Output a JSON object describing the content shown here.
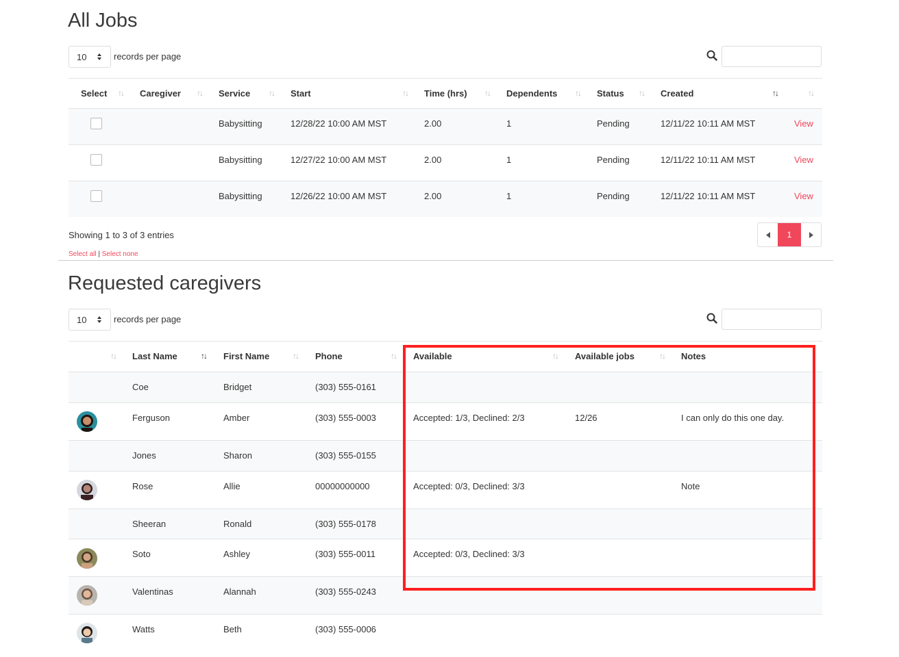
{
  "jobs": {
    "title": "All Jobs",
    "length_value": "10",
    "length_label": "records per page",
    "columns": [
      "Select",
      "Caregiver",
      "Service",
      "Start",
      "Time (hrs)",
      "Dependents",
      "Status",
      "Created"
    ],
    "rows": [
      {
        "caregiver": "",
        "service": "Babysitting",
        "start": "12/28/22 10:00 AM MST",
        "time": "2.00",
        "dependents": "1",
        "status": "Pending",
        "created": "12/11/22 10:11 AM MST",
        "action": "View"
      },
      {
        "caregiver": "",
        "service": "Babysitting",
        "start": "12/27/22 10:00 AM MST",
        "time": "2.00",
        "dependents": "1",
        "status": "Pending",
        "created": "12/11/22 10:11 AM MST",
        "action": "View"
      },
      {
        "caregiver": "",
        "service": "Babysitting",
        "start": "12/26/22 10:00 AM MST",
        "time": "2.00",
        "dependents": "1",
        "status": "Pending",
        "created": "12/11/22 10:11 AM MST",
        "action": "View"
      }
    ],
    "info": "Showing 1 to 3 of 3 entries",
    "select_all": "Select all",
    "separator": " | ",
    "select_none": "Select none",
    "current_page": "1"
  },
  "caregivers": {
    "title": "Requested caregivers",
    "length_value": "10",
    "length_label": "records per page",
    "columns": [
      "Last Name",
      "First Name",
      "Phone",
      "Available",
      "Available jobs",
      "Notes"
    ],
    "rows": [
      {
        "avatar": "",
        "last": "Coe",
        "first": "Bridget",
        "phone": "(303) 555-0161",
        "available": "",
        "jobs": "",
        "notes": ""
      },
      {
        "avatar": "avatar-1",
        "last": "Ferguson",
        "first": "Amber",
        "phone": "(303) 555-0003",
        "available": "Accepted: 1/3, Declined: 2/3",
        "jobs": "12/26",
        "notes": "I can only do this one day."
      },
      {
        "avatar": "",
        "last": "Jones",
        "first": "Sharon",
        "phone": "(303) 555-0155",
        "available": "",
        "jobs": "",
        "notes": ""
      },
      {
        "avatar": "avatar-2",
        "last": "Rose",
        "first": "Allie",
        "phone": "00000000000",
        "available": "Accepted: 0/3, Declined: 3/3",
        "jobs": "",
        "notes": "Note"
      },
      {
        "avatar": "",
        "last": "Sheeran",
        "first": "Ronald",
        "phone": "(303) 555-0178",
        "available": "",
        "jobs": "",
        "notes": ""
      },
      {
        "avatar": "avatar-3",
        "last": "Soto",
        "first": "Ashley",
        "phone": "(303) 555-0011",
        "available": "Accepted: 0/3, Declined: 3/3",
        "jobs": "",
        "notes": ""
      },
      {
        "avatar": "avatar-4",
        "last": "Valentinas",
        "first": "Alannah",
        "phone": "(303) 555-0243",
        "available": "",
        "jobs": "",
        "notes": ""
      },
      {
        "avatar": "avatar-5",
        "last": "Watts",
        "first": "Beth",
        "phone": "(303) 555-0006",
        "available": "",
        "jobs": "",
        "notes": ""
      }
    ]
  },
  "colors": {
    "accent": "#f0475b",
    "highlight": "#ff1f1f",
    "stripe": "#f8f9fa"
  },
  "icons": [
    "search-icon",
    "sort-icon",
    "caret-left-icon",
    "caret-right-icon",
    "select-arrows-icon"
  ]
}
